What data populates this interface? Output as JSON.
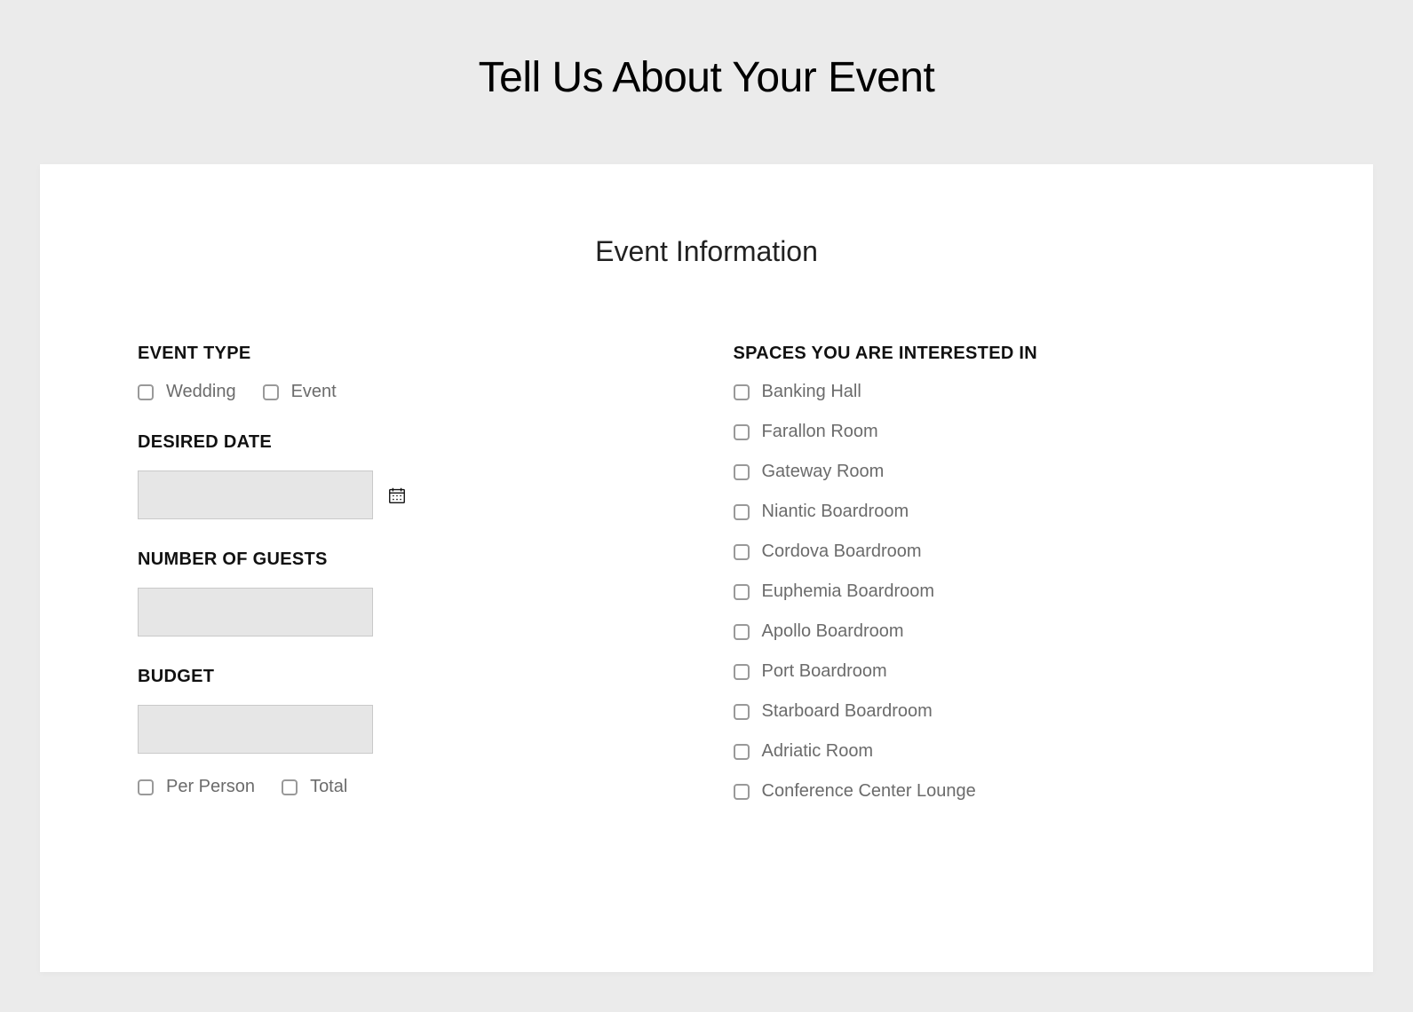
{
  "page": {
    "title": "Tell Us About Your Event"
  },
  "form": {
    "section_title": "Event Information",
    "event_type": {
      "label": "EVENT TYPE",
      "options": {
        "wedding": "Wedding",
        "event": "Event"
      }
    },
    "desired_date": {
      "label": "DESIRED DATE",
      "value": ""
    },
    "guests": {
      "label": "NUMBER OF GUESTS",
      "value": ""
    },
    "budget": {
      "label": "BUDGET",
      "value": "",
      "options": {
        "per_person": "Per Person",
        "total": "Total"
      }
    },
    "spaces": {
      "label": "SPACES YOU ARE INTERESTED IN",
      "items": [
        "Banking Hall",
        "Farallon Room",
        "Gateway Room",
        "Niantic Boardroom",
        "Cordova Boardroom",
        "Euphemia Boardroom",
        "Apollo Boardroom",
        "Port Boardroom",
        "Starboard Boardroom",
        "Adriatic Room",
        "Conference Center Lounge"
      ]
    }
  }
}
